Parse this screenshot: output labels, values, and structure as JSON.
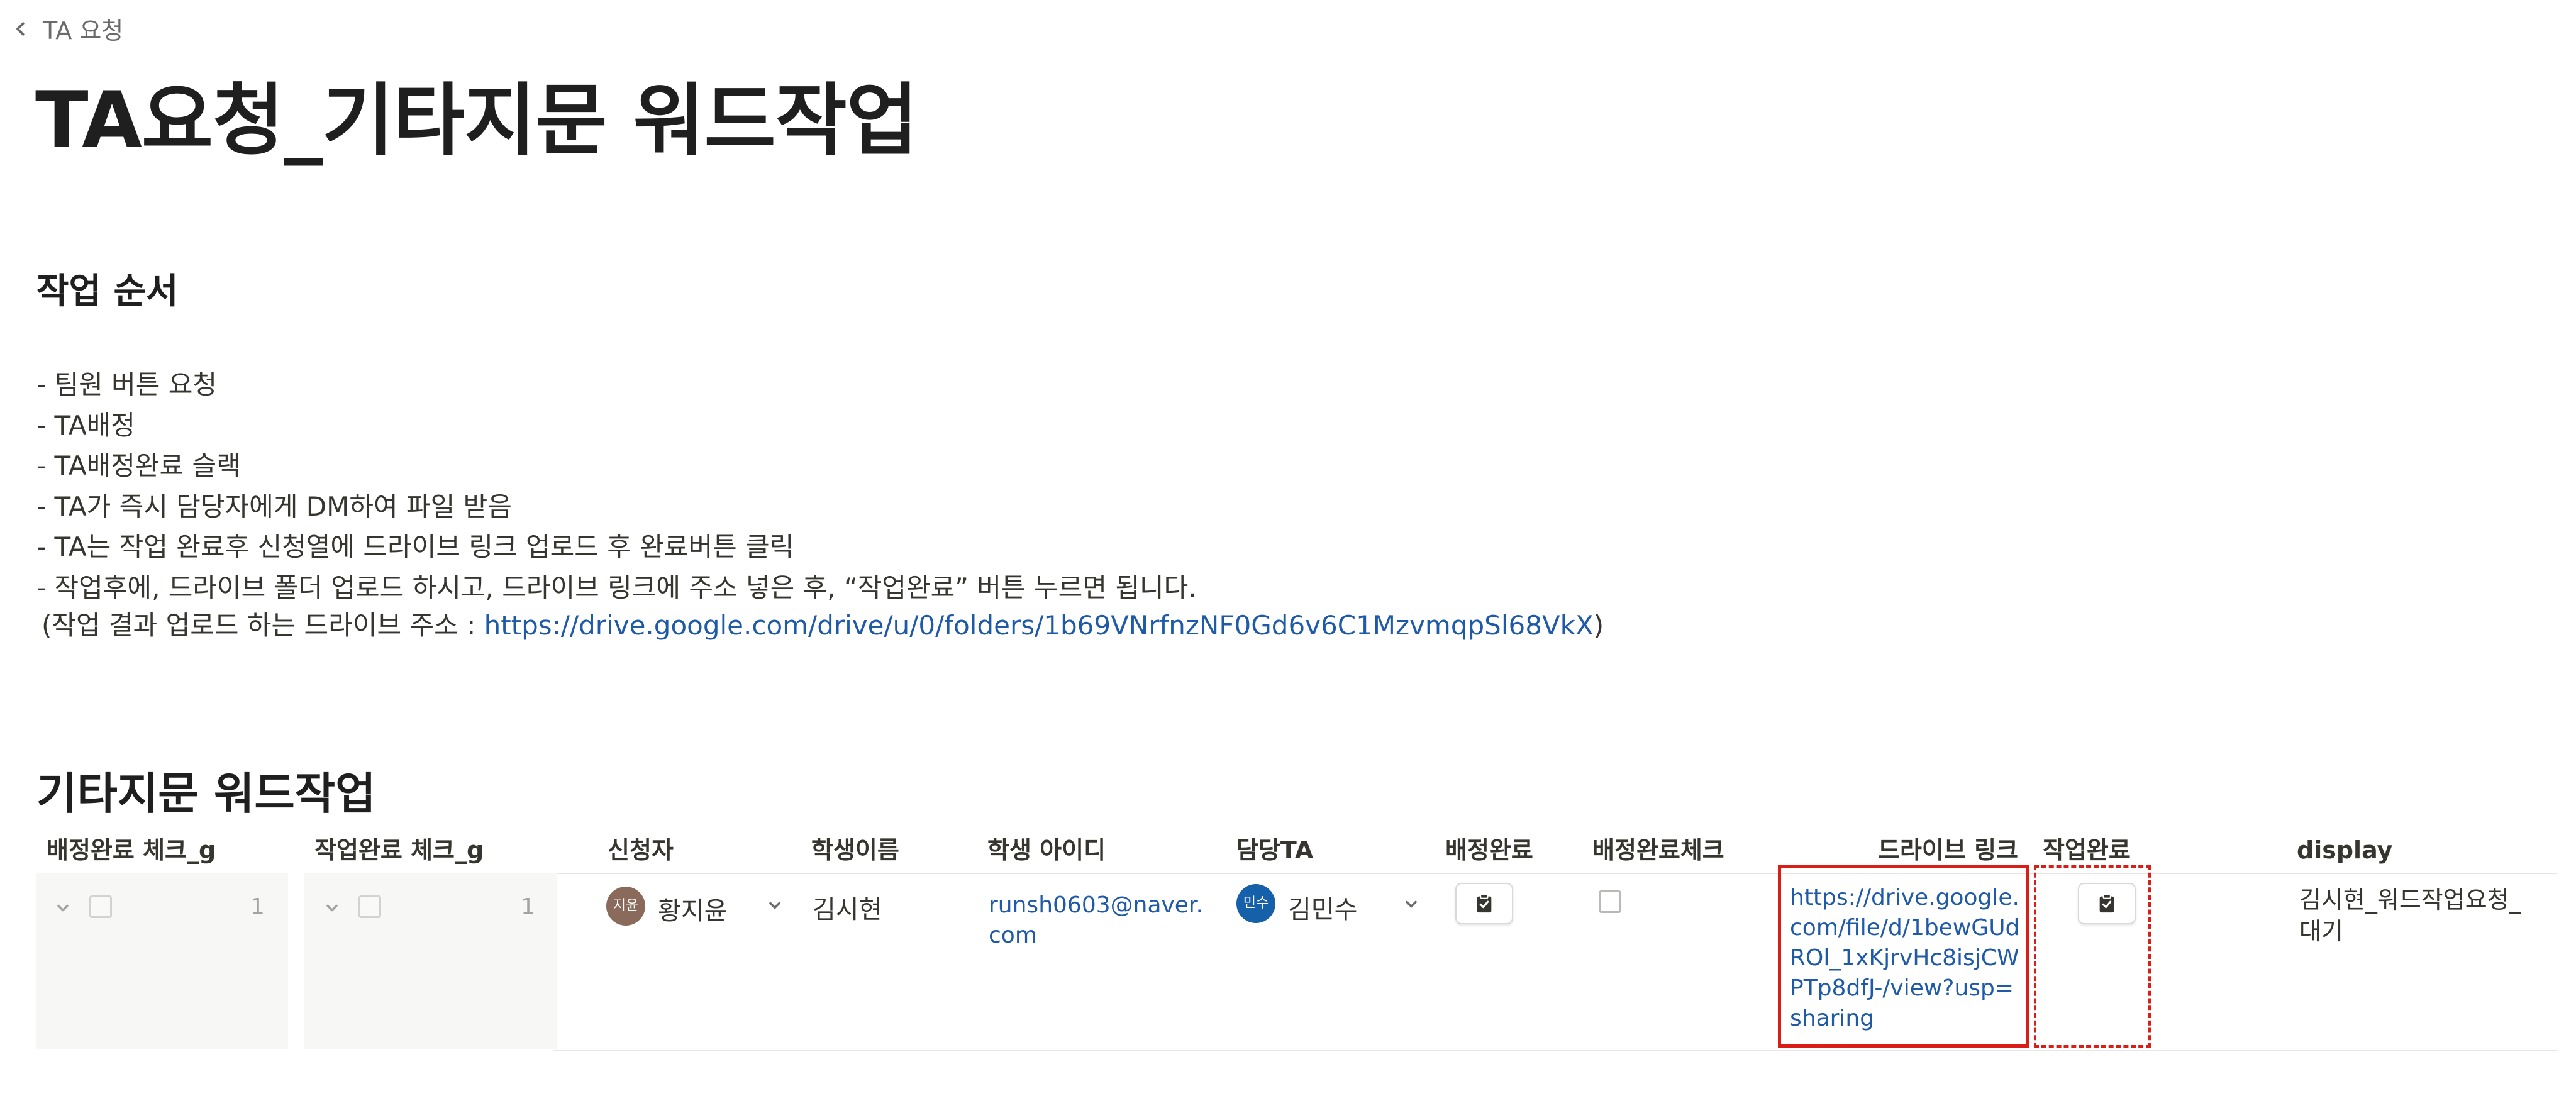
{
  "breadcrumb": {
    "label": "TA 요청"
  },
  "page": {
    "title": "TA요청_기타지문 워드작업"
  },
  "instructions": {
    "heading": "작업 순서",
    "steps": [
      "- 팀원 버튼 요청",
      "- TA배정",
      "- TA배정완료 슬랙",
      "- TA가 즉시 담당자에게 DM하여 파일 받음",
      "- TA는 작업 완료후 신청열에 드라이브 링크 업로드 후 완료버튼 클릭",
      "- 작업후에, 드라이브 폴더 업로드 하시고, 드라이브 링크에 주소 넣은 후, “작업완료” 버튼 누르면 됩니다."
    ],
    "drive_prefix": "(작업 결과 업로드 하는 드라이브 주소 : ",
    "drive_url": "https://drive.google.com/drive/u/0/folders/1b69VNrfnzNF0Gd6v6C1MzvmqpSl68VkX",
    "drive_suffix": ")"
  },
  "database": {
    "title": "기타지문 워드작업",
    "columns": {
      "assign_check_g": "배정완료 체크_g",
      "done_check_g": "작업완료 체크_g",
      "requester": "신청자",
      "student_name": "학생이름",
      "student_id": "학생 아이디",
      "ta": "담당TA",
      "assign_done": "배정완료",
      "assign_done_check": "배정완료체크",
      "drive_link": "드라이브 링크",
      "work_done": "작업완료",
      "display": "display"
    },
    "row": {
      "assign_count": "1",
      "done_count": "1",
      "requester_initials": "지윤",
      "requester_name": "황지윤",
      "student_name": "김시현",
      "student_id": "runsh0603@naver.com",
      "ta_initials": "민수",
      "ta_name": "김민수",
      "drive_link": "https://drive.google.com/file/d/1bewGUdROl_1xKjrvHc8isjCWPTp8dfJ-/view?usp=sharing",
      "display": "김시현_워드작업요청_대기"
    }
  },
  "colors": {
    "link": "#1e5aa8",
    "highlight": "#d91e18",
    "requester_avatar": "#8a6a5a",
    "ta_avatar": "#1560a8"
  },
  "icons": [
    "chevron-left-icon",
    "chevron-down-icon",
    "checkbox-icon",
    "clipboard-check-icon"
  ]
}
